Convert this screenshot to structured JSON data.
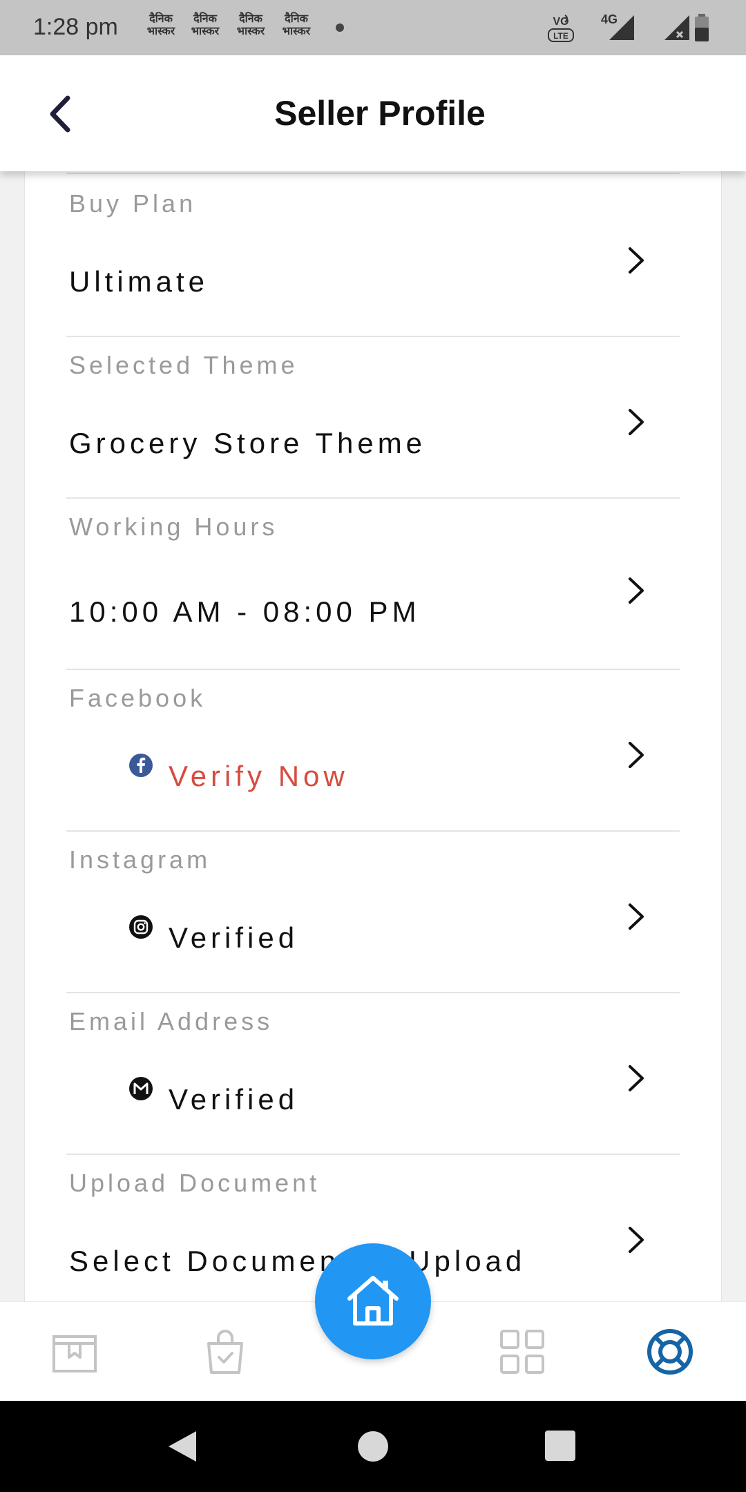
{
  "status_bar": {
    "time": "1:28 pm",
    "notification_text": "दैनिक भास्कर",
    "notification_count": 4,
    "network_label": "4G",
    "volte_label": "VoLTE"
  },
  "header": {
    "title": "Seller Profile",
    "back_icon": "chevron-left-icon"
  },
  "profile_rows": [
    {
      "label": "Buy Plan",
      "value": "Ultimate",
      "icon": null,
      "value_color": "#111111"
    },
    {
      "label": "Selected Theme",
      "value": "Grocery Store Theme",
      "icon": null,
      "value_color": "#111111"
    },
    {
      "label": "Working Hours",
      "value": "10:00 AM - 08:00 PM",
      "icon": null,
      "value_color": "#111111"
    },
    {
      "label": "Facebook",
      "value": "Verify Now",
      "icon": "facebook-icon",
      "value_color": "#d84b3f"
    },
    {
      "label": "Instagram",
      "value": "Verified",
      "icon": "instagram-icon",
      "value_color": "#111111"
    },
    {
      "label": "Email Address",
      "value": "Verified",
      "icon": "gmail-icon",
      "value_color": "#111111"
    },
    {
      "label": "Upload Document",
      "value": "Select Document to Upload",
      "icon": null,
      "value_color": "#111111"
    }
  ],
  "bottom_nav": {
    "items": [
      "store-icon",
      "shopping-bag-check-icon",
      "home-icon",
      "grid-icon",
      "lifebuoy-icon"
    ],
    "active": "lifebuoy-icon"
  },
  "colors": {
    "accent": "#2196f3",
    "active_nav": "#1565a6",
    "inactive_nav": "#c4c4c4",
    "facebook": "#3b5998",
    "warning_text": "#d84b3f"
  }
}
